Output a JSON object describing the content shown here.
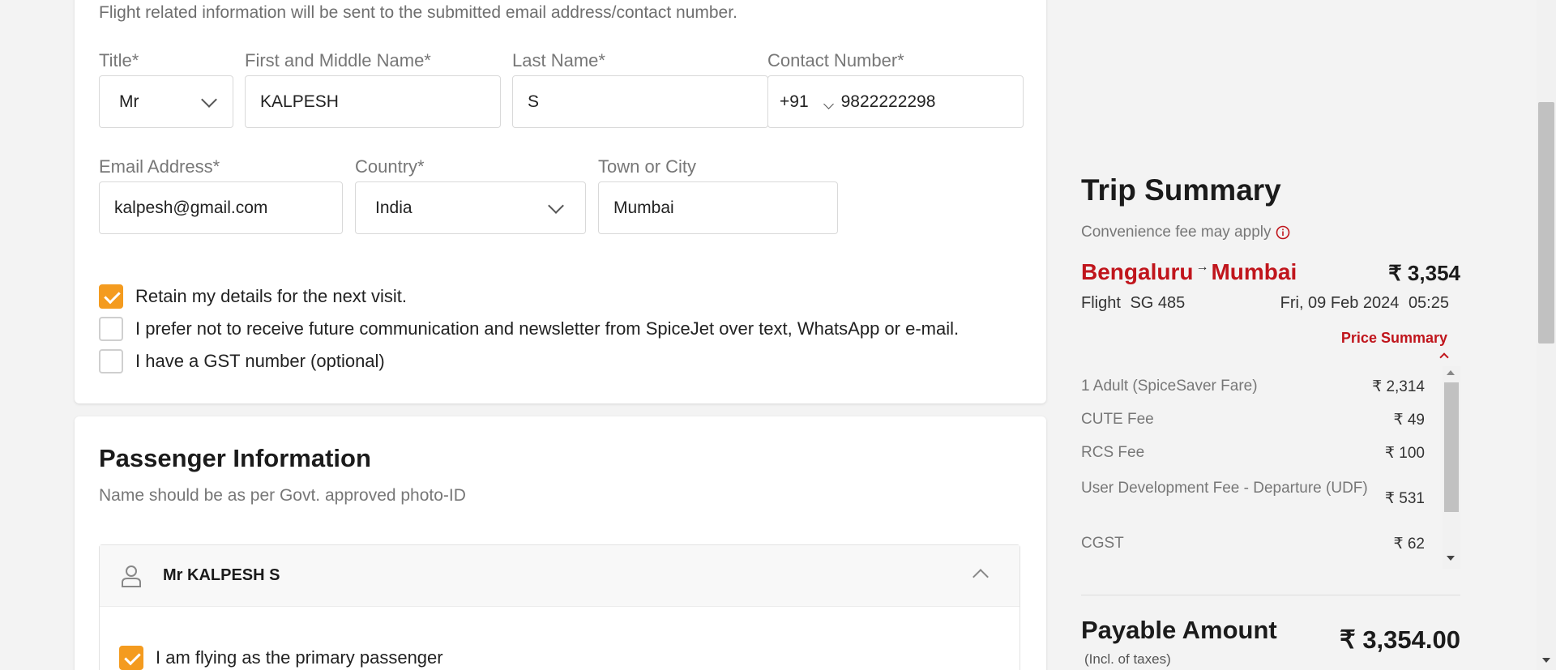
{
  "contact": {
    "note": "Flight related information will be sent to the submitted email address/contact number.",
    "title_label": "Title*",
    "title_value": "Mr",
    "first_name_label": "First and Middle Name*",
    "first_name_value": "KALPESH",
    "last_name_label": "Last Name*",
    "last_name_value": "S",
    "contact_label": "Contact Number*",
    "country_code": "+91",
    "contact_value": "9822222298",
    "email_label": "Email Address*",
    "email_value": "kalpesh@gmail.com",
    "country_label": "Country*",
    "country_value": "India",
    "city_label": "Town or City",
    "city_value": "Mumbai",
    "checks": [
      {
        "label": "Retain my details for the next visit.",
        "checked": true
      },
      {
        "label": "I prefer not to receive future communication and newsletter from SpiceJet over text, WhatsApp or e-mail.",
        "checked": false
      },
      {
        "label": "I have a GST number (optional)",
        "checked": false
      }
    ]
  },
  "passenger": {
    "title": "Passenger Information",
    "subtitle": "Name should be as per Govt. approved photo-ID",
    "name": "Mr KALPESH S",
    "primary_label": "I am flying as the primary passenger",
    "primary_checked": true
  },
  "summary": {
    "title": "Trip Summary",
    "fee_note": "Convenience fee may apply",
    "origin": "Bengaluru",
    "destination": "Mumbai",
    "arrow": "→",
    "total_short": "₹ 3,354",
    "flight_label": "Flight",
    "flight_no": "SG 485",
    "date": "Fri, 09 Feb 2024",
    "time": "05:25",
    "price_summary_label": "Price Summary",
    "items": [
      {
        "label": "1 Adult  (SpiceSaver Fare)",
        "value": "₹ 2,314"
      },
      {
        "label": "CUTE Fee",
        "value": "₹ 49"
      },
      {
        "label": "RCS Fee",
        "value": "₹ 100"
      },
      {
        "label": "User Development Fee - Departure (UDF)",
        "value": "₹ 531"
      },
      {
        "label": "CGST",
        "value": "₹ 62"
      }
    ],
    "payable_label": "Payable Amount",
    "payable_value": "₹ 3,354.00",
    "tax_note": "(Incl. of taxes)"
  },
  "colors": {
    "accent": "#f49b1f",
    "brand_red": "#c0151c"
  }
}
